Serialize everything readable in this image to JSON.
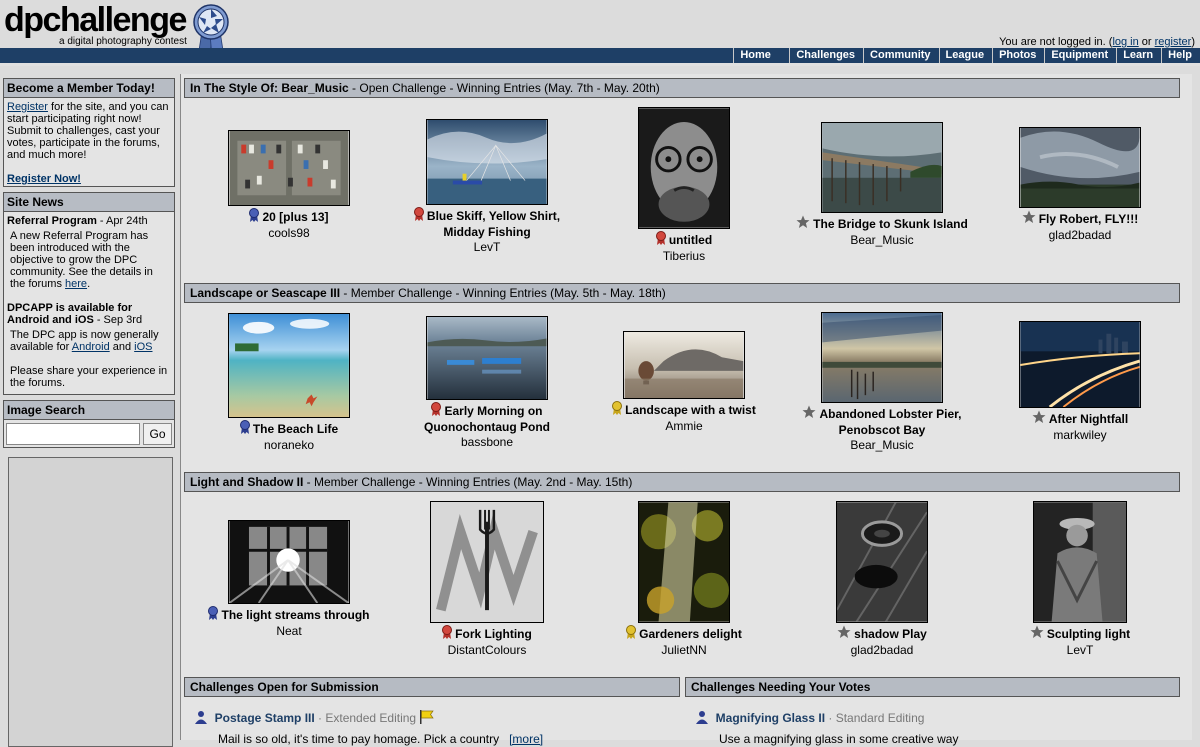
{
  "site": {
    "logo_text": "dpchallenge",
    "tagline": "a digital photography contest",
    "login_prefix": "You are not logged in. (",
    "login_link": "log in",
    "login_or": " or ",
    "register_link": "register",
    "login_suffix": ")"
  },
  "nav": [
    "Home",
    "Challenges",
    "Community",
    "League",
    "Photos",
    "Equipment",
    "Learn",
    "Help"
  ],
  "sidebar": {
    "member": {
      "title": "Become a Member Today!",
      "register_link": "Register",
      "text": " for the site, and you can start participating right now! Submit to challenges, cast your votes, participate in the forums, and much more!",
      "register_now": "Register Now!"
    },
    "news": {
      "title": "Site News",
      "item1_title": "Referral Program",
      "item1_date": " - Apr 24th",
      "item1_text": "A new Referral Program has been introduced with the objective to grow the DPC community. See the details in the forums ",
      "item1_link": "here",
      "item1_end": ".",
      "item2_title": "DPCAPP is available for Android and iOS",
      "item2_date": " - Sep 3rd",
      "item2_text": "The DPC app is now generally available for ",
      "item2_android": "Android",
      "item2_and": " and ",
      "item2_ios": "iOS",
      "item2_text2": "Please share your experience in the forums."
    },
    "search": {
      "title": "Image Search",
      "button": "Go"
    }
  },
  "sections": [
    {
      "name": "In The Style Of: Bear_Music",
      "detail": " - Open Challenge - Winning Entries (May. 7th - May. 20th)",
      "entries": [
        {
          "award": "blue",
          "title": "20 [plus 13]",
          "author": "cools98"
        },
        {
          "award": "red",
          "title": "Blue Skiff, Yellow Shirt, Midday Fishing",
          "author": "LevT"
        },
        {
          "award": "red",
          "title": "untitled",
          "author": "Tiberius"
        },
        {
          "award": "star",
          "title": "The Bridge to Skunk Island",
          "author": "Bear_Music"
        },
        {
          "award": "star",
          "title": "Fly Robert, FLY!!!",
          "author": "glad2badad"
        }
      ]
    },
    {
      "name": "Landscape or Seascape III",
      "detail": " - Member Challenge - Winning Entries (May. 5th - May. 18th)",
      "entries": [
        {
          "award": "blue",
          "title": "The Beach Life",
          "author": "noraneko"
        },
        {
          "award": "red",
          "title": "Early Morning on Quonochontaug Pond",
          "author": "bassbone"
        },
        {
          "award": "yellow",
          "title": "Landscape with a twist",
          "author": "Ammie"
        },
        {
          "award": "star",
          "title": "Abandoned Lobster Pier, Penobscot Bay",
          "author": "Bear_Music"
        },
        {
          "award": "star",
          "title": "After Nightfall",
          "author": "markwiley"
        }
      ]
    },
    {
      "name": "Light and Shadow II",
      "detail": " - Member Challenge - Winning Entries (May. 2nd - May. 15th)",
      "entries": [
        {
          "award": "blue",
          "title": "The light streams through",
          "author": "Neat"
        },
        {
          "award": "red",
          "title": "Fork Lighting",
          "author": "DistantColours"
        },
        {
          "award": "yellow",
          "title": "Gardeners delight",
          "author": "JulietNN"
        },
        {
          "award": "star",
          "title": "shadow Play",
          "author": "glad2badad"
        },
        {
          "award": "star",
          "title": "Sculpting light",
          "author": "LevT"
        }
      ]
    }
  ],
  "open_challenges": {
    "title": "Challenges Open for Submission",
    "name": "Postage Stamp III",
    "sep": " · ",
    "type": "Extended Editing",
    "desc": "Mail is so old, it's time to pay homage. Pick a country",
    "more": "[more]"
  },
  "vote_challenges": {
    "title": "Challenges Needing Your Votes",
    "name": "Magnifying Glass II",
    "sep": " · ",
    "type": "Standard Editing",
    "desc": "Use a magnifying glass in some creative way"
  },
  "colors": {
    "nav_bg": "#1e3f66",
    "section_bar": "#b6bbc3",
    "link": "#003366",
    "ribbon_blue": "#2c3d8f",
    "ribbon_red": "#b3302a",
    "ribbon_yellow": "#d4b21a",
    "star": "#666666"
  }
}
